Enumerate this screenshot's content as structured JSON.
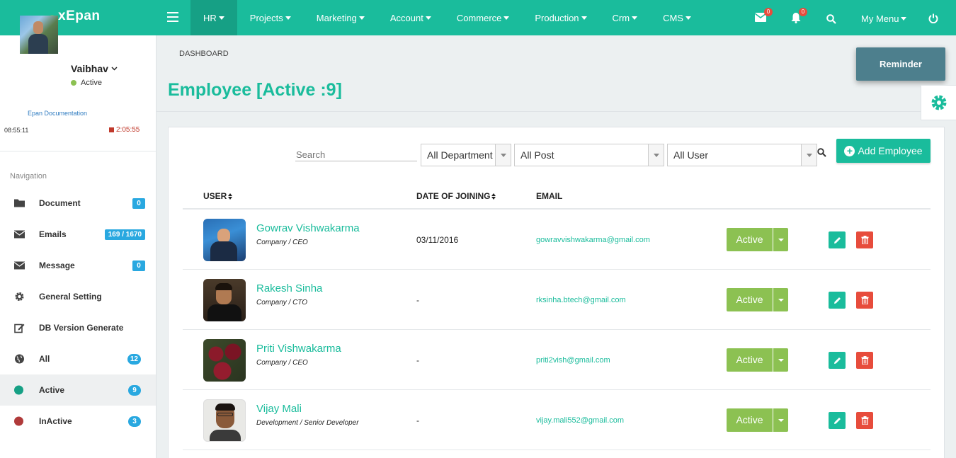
{
  "brand": {
    "name": "xEpan"
  },
  "topnav": {
    "items": [
      {
        "label": "HR",
        "active": true
      },
      {
        "label": "Projects"
      },
      {
        "label": "Marketing"
      },
      {
        "label": "Account"
      },
      {
        "label": "Commerce"
      },
      {
        "label": "Production"
      },
      {
        "label": "Crm"
      },
      {
        "label": "CMS"
      }
    ],
    "mail_count": "0",
    "notification_count": "0",
    "my_menu": "My Menu"
  },
  "user": {
    "name": "Vaibhav",
    "status": "Active",
    "doc_link": "Epan Documentation",
    "clock": "08:55:11",
    "timer": "2:05:55"
  },
  "sidebar": {
    "nav_label": "Navigation",
    "items": [
      {
        "label": "Document",
        "count": "0",
        "icon": "folder-icon"
      },
      {
        "label": "Emails",
        "count": "169 / 1670",
        "icon": "envelope-icon"
      },
      {
        "label": "Message",
        "count": "0",
        "icon": "envelope-icon"
      },
      {
        "label": "General Setting",
        "count": "",
        "icon": "gear-icon"
      },
      {
        "label": "DB Version Generate",
        "count": "",
        "icon": "edit-icon"
      },
      {
        "label": "All",
        "count": "12",
        "icon": "globe-icon"
      },
      {
        "label": "Active",
        "count": "9",
        "icon": "green-circle-icon",
        "active": true
      },
      {
        "label": "InActive",
        "count": "3",
        "icon": "red-circle-icon"
      }
    ]
  },
  "breadcrumb": "DASHBOARD",
  "page_title": "Employee [Active :9]",
  "reminder_label": "Reminder",
  "filters": {
    "search_placeholder": "Search",
    "department": "All Department",
    "post": "All Post",
    "user": "All User"
  },
  "add_employee_label": "Add Employee",
  "table": {
    "headers": {
      "user": "USER",
      "doj": "DATE OF JOINING",
      "email": "EMAIL"
    },
    "rows": [
      {
        "name": "Gowrav Vishwakarma",
        "post": "Company / CEO",
        "doj": "03/11/2016",
        "email": "gowravvishwakarma@gmail.com",
        "status": "Active"
      },
      {
        "name": "Rakesh Sinha",
        "post": "Company / CTO",
        "doj": "-",
        "email": "rksinha.btech@gmail.com",
        "status": "Active"
      },
      {
        "name": "Priti Vishwakarma",
        "post": "Company / CEO",
        "doj": "-",
        "email": "priti2vish@gmail.com",
        "status": "Active"
      },
      {
        "name": "Vijay Mali",
        "post": "Development / Senior Developer",
        "doj": "-",
        "email": "vijay.mali552@gmail.com",
        "status": "Active"
      }
    ]
  },
  "colors": {
    "brand": "#1abc9c",
    "brand_dark": "#16a085",
    "status_active": "#8cc152",
    "delete": "#e74c3c",
    "badge": "#29a8e0"
  }
}
